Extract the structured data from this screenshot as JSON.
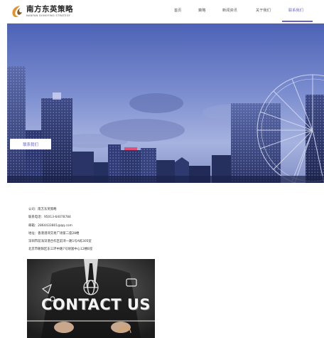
{
  "brand": {
    "name_cn": "南方东英策略",
    "name_en": "NANFAN DONGYING STRATEGY"
  },
  "nav": {
    "items": [
      {
        "label": "首页",
        "active": false
      },
      {
        "label": "策略",
        "active": false
      },
      {
        "label": "新闻资讯",
        "active": false
      },
      {
        "label": "关于我们",
        "active": false
      },
      {
        "label": "联系我们",
        "active": true
      }
    ]
  },
  "banner": {
    "button_label": "联系我们"
  },
  "contact": {
    "lines": [
      "公司：南方东英策略",
      "联系电话：95013-64078784",
      "邮箱：2864433801@qq.com",
      "地址：香港港湾交易广场第二座28楼",
      "深圳市前海深港合作区前湾一路1号A栋305室",
      "北京市朝阳区东三环中路7号财富中心12楼B室"
    ],
    "image_text": "CONTACT US"
  },
  "colors": {
    "accent": "#6a64c8",
    "text": "#333333",
    "background": "#ffffff"
  }
}
